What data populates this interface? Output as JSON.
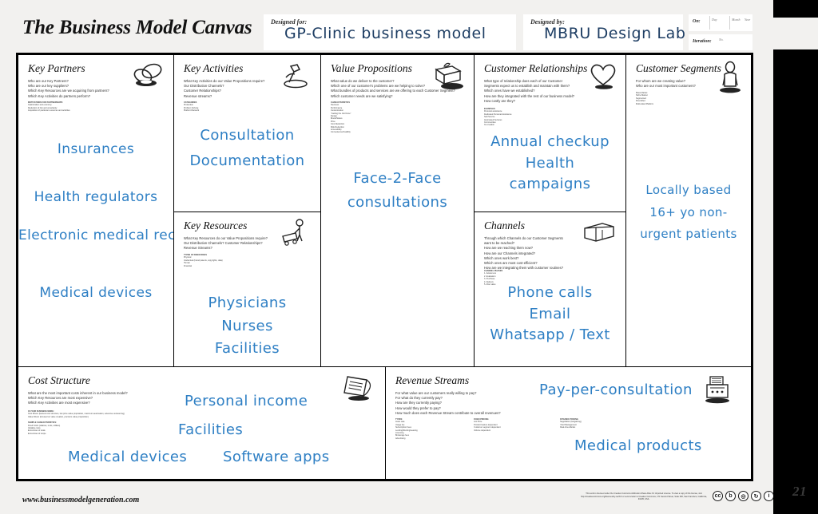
{
  "slide": {
    "number": "21",
    "title": "The Business Model Canvas",
    "footer_url": "www.businessmodelgeneration.com",
    "accent_handwriting_color": "#2E7FC4",
    "legal_text": "This work is licensed under the Creative Commons Attribution-Share Alike 3.0 Unported License. To view a copy of this license, visit http://creativecommons.org/licenses/by-sa/3.0/ or send a letter to Creative Commons, 171 Second Street, Suite 300, San Francisco, California, 94105, USA."
  },
  "header": {
    "designed_for_label": "Designed for:",
    "designed_for_value": "GP-Clinic business model",
    "designed_by_label": "Designed by:",
    "designed_by_value": "MBRU Design Lab",
    "on_label": "On:",
    "on_day": "Day",
    "on_month": "Month",
    "on_year": "Year",
    "iteration_label": "Iteration:",
    "iteration_no": "No."
  },
  "cells": {
    "key_partners": {
      "title": "Key Partners",
      "icon": "chain-links-icon",
      "questions": "Who are our Key Partners?\nWho are our key suppliers?\nWhich Key Resources are we acquiring from partners?\nWhich Key Activities do partners perform?",
      "fine_heading": "MOTIVATIONS FOR PARTNERSHIPS:",
      "fine_body": "Optimization and economy\nReduction of risk and uncertainty\nAcquisition of particular resources and activities",
      "notes": [
        "Insurances",
        "Health regulators",
        "Electronic medical records software",
        "Medical devices"
      ]
    },
    "key_activities": {
      "title": "Key Activities",
      "icon": "hammer-icon",
      "questions": "What Key Activities do our Value Propositions require?\nOur Distribution Channels?\nCustomer Relationships?\nRevenue streams?",
      "fine_heading": "CATEGORIES",
      "fine_body": "Production\nProblem Solving\nPlatform/Network",
      "notes": [
        "Consultation",
        "Documentation"
      ]
    },
    "key_resources": {
      "title": "Key Resources",
      "icon": "worker-cart-icon",
      "questions": "What Key Resources do our Value Propositions require?\nOur Distribution Channels? Customer Relationships?\nRevenue Streams?",
      "fine_heading": "TYPES OF RESOURCES",
      "fine_body": "Physical\nIntellectual (brand patents, copyrights, data)\nHuman\nFinancial",
      "notes": [
        "Physicians",
        "Nurses",
        "Facilities"
      ]
    },
    "value_propositions": {
      "title": "Value Propositions",
      "icon": "gift-package-icon",
      "questions": "What value do we deliver to the customer?\nWhich one of our customer's problems are we helping to solve?\nWhat bundles of products and services are we offering to each Customer Segment?\nWhich customer needs are we satisfying?",
      "fine_heading": "CHARACTERISTICS",
      "fine_body": "Newness\nPerformance\nCustomization\n\"Getting the Job Done\"\nDesign\nBrand/Status\nPrice\nCost Reduction\nRisk Reduction\nAccessibility\nConvenience/Usability",
      "notes": [
        "Face-2-Face",
        "consultations"
      ]
    },
    "customer_relationships": {
      "title": "Customer Relationships",
      "icon": "heart-icon",
      "questions": "What type of relationship does each of our Customer\nSegments expect us to establish and maintain with them?\nWhich ones have we established?\nHow are they integrated with the rest of our business model?\nHow costly are they?",
      "fine_heading": "EXAMPLES",
      "fine_body": "Personal assistance\nDedicated Personal Assistance\nSelf-Service\nAutomated Services\nCommunities\nCo-creation",
      "notes": [
        "Annual checkup",
        "Health",
        "campaigns"
      ]
    },
    "channels": {
      "title": "Channels",
      "icon": "delivery-truck-icon",
      "questions": "Through which Channels do our Customer Segments\nwant to be reached?\nHow are we reaching them now?\nHow are our Channels integrated?\nWhich ones work best?\nWhich ones are most cost-efficient?\nHow are we integrating them with customer routines?",
      "fine_heading": "CHANNEL PHASES",
      "fine_body": "1. Awareness\n2. Evaluation\n3. Purchase\n4. Delivery\n5. After sales",
      "notes": [
        "Phone calls",
        "Email",
        "Whatsapp / Text"
      ]
    },
    "customer_segments": {
      "title": "Customer Segments",
      "icon": "person-icon",
      "questions": "For whom are we creating value?\nWho are our most important customers?",
      "fine_heading": "",
      "fine_body": "Mass Market\nNiche Market\nSegmented\nDiversified\nMulti-sided Platform",
      "notes": [
        "Locally based",
        "16+ yo non-",
        "urgent patients"
      ]
    },
    "cost_structure": {
      "title": "Cost Structure",
      "icon": "invoice-icon",
      "questions": "What are the most important costs inherent in our business model?\nWhich Key Resources are most expensive?\nWhich Key Activities are most expensive?",
      "fine_heading": "IS YOUR BUSINESS MORE:",
      "fine_body": "Cost Driven (leanest cost structure, low price value proposition, maximum automation, extensive outsourcing)\nValue Driven (focused on value creation, premium value proposition)",
      "fine_heading2": "SAMPLE CHARACTERISTICS:",
      "fine_body2": "Fixed Costs (salaries, rents, utilities)\nVariable costs\nEconomies of scale\nEconomies of scope",
      "notes": [
        "Personal income",
        "Facilities",
        "Medical devices",
        "Software apps"
      ]
    },
    "revenue_streams": {
      "title": "Revenue Streams",
      "icon": "cash-register-icon",
      "questions": "For what value are our customers really willing to pay?\nFor what do they currently pay?\nHow are they currently paying?\nHow would they prefer to pay?\nHow much does each Revenue Stream contribute to overall revenues?",
      "fine_heading": "TYPES:",
      "fine_body": "Asset sale\nUsage fee\nSubscription Fees\nLending/Renting/Leasing\nLicensing\nBrokerage fees\nAdvertising",
      "fine_heading2": "FIXED PRICING",
      "fine_body2": "List Price\nProduct feature dependent\nCustomer segment dependent\nVolume dependent",
      "fine_heading3": "DYNAMIC PRICING",
      "fine_body3": "Negotiation (bargaining)\nYield Management\nReal-time-Market",
      "notes": [
        "Pay-per-consultation",
        "Medical products"
      ]
    }
  },
  "cc_badges": [
    "cc",
    "by",
    "nc",
    "sa",
    "info"
  ]
}
